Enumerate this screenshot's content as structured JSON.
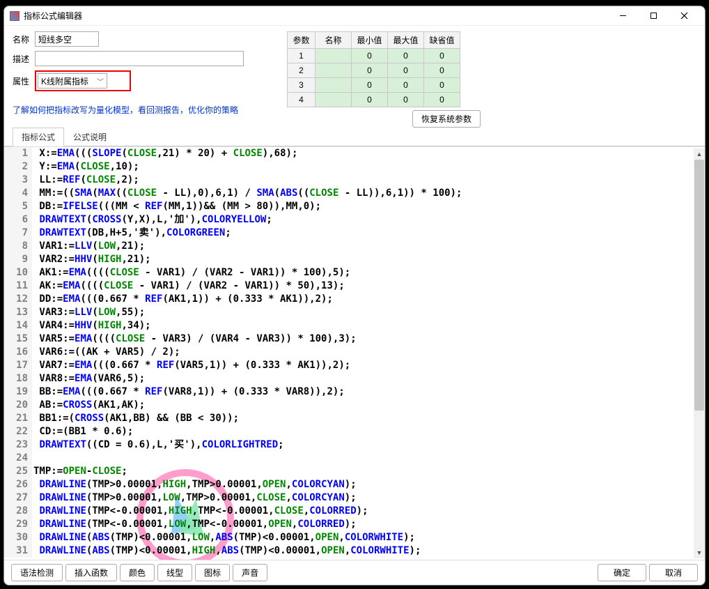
{
  "window": {
    "title": "指标公式编辑器"
  },
  "form": {
    "name_label": "名称",
    "name_value": "短线多空",
    "desc_label": "描述",
    "desc_value": "",
    "attr_label": "属性",
    "attr_value": "K线附属指标"
  },
  "quant_link": "了解如何把指标改写为量化模型，看回测报告，优化你的策略",
  "params": {
    "headers": {
      "param": "参数",
      "name": "名称",
      "min": "最小值",
      "max": "最大值",
      "def": "缺省值"
    },
    "rows": [
      {
        "idx": "1",
        "name": "",
        "min": "0",
        "max": "0",
        "def": "0"
      },
      {
        "idx": "2",
        "name": "",
        "min": "0",
        "max": "0",
        "def": "0"
      },
      {
        "idx": "3",
        "name": "",
        "min": "0",
        "max": "0",
        "def": "0"
      },
      {
        "idx": "4",
        "name": "",
        "min": "0",
        "max": "0",
        "def": "0"
      }
    ],
    "restore": "恢复系统参数"
  },
  "tabs": {
    "formula": "指标公式",
    "desc": "公式说明"
  },
  "footer": {
    "syntax": "语法检测",
    "insert_fn": "插入函数",
    "color": "颜色",
    "line": "线型",
    "icon": "图标",
    "sound": "声音",
    "ok": "确定",
    "cancel": "取消"
  },
  "code": [
    {
      "n": "1",
      "seg": [
        [
          "blk",
          " X:="
        ],
        [
          "kw",
          "EMA"
        ],
        [
          "blk",
          "((("
        ],
        [
          "kw",
          "SLOPE"
        ],
        [
          "blk",
          "("
        ],
        [
          "grn",
          "CLOSE"
        ],
        [
          "blk",
          ",21) * 20) + "
        ],
        [
          "grn",
          "CLOSE"
        ],
        [
          "blk",
          "),68);"
        ]
      ]
    },
    {
      "n": "2",
      "seg": [
        [
          "blk",
          " Y:="
        ],
        [
          "kw",
          "EMA"
        ],
        [
          "blk",
          "("
        ],
        [
          "grn",
          "CLOSE"
        ],
        [
          "blk",
          ",10);"
        ]
      ]
    },
    {
      "n": "3",
      "seg": [
        [
          "blk",
          " LL:="
        ],
        [
          "kw",
          "REF"
        ],
        [
          "blk",
          "("
        ],
        [
          "grn",
          "CLOSE"
        ],
        [
          "blk",
          ",2);"
        ]
      ]
    },
    {
      "n": "4",
      "seg": [
        [
          "blk",
          " MM:=(("
        ],
        [
          "kw",
          "SMA"
        ],
        [
          "blk",
          "("
        ],
        [
          "kw",
          "MAX"
        ],
        [
          "blk",
          "(("
        ],
        [
          "grn",
          "CLOSE"
        ],
        [
          "blk",
          " - LL),0),6,1) / "
        ],
        [
          "kw",
          "SMA"
        ],
        [
          "blk",
          "("
        ],
        [
          "kw",
          "ABS"
        ],
        [
          "blk",
          "(("
        ],
        [
          "grn",
          "CLOSE"
        ],
        [
          "blk",
          " - LL)),6,1)) * 100);"
        ]
      ]
    },
    {
      "n": "5",
      "seg": [
        [
          "blk",
          " DB:="
        ],
        [
          "kw",
          "IFELSE"
        ],
        [
          "blk",
          "(((MM < "
        ],
        [
          "kw",
          "REF"
        ],
        [
          "blk",
          "(MM,1))&& (MM > 80)),MM,0);"
        ]
      ]
    },
    {
      "n": "6",
      "seg": [
        [
          "blk",
          " "
        ],
        [
          "kw",
          "DRAWTEXT"
        ],
        [
          "blk",
          "("
        ],
        [
          "kw",
          "CROSS"
        ],
        [
          "blk",
          "(Y,X),L,'加'),"
        ],
        [
          "kw",
          "COLORYELLOW"
        ],
        [
          "blk",
          ";"
        ]
      ]
    },
    {
      "n": "7",
      "seg": [
        [
          "blk",
          " "
        ],
        [
          "kw",
          "DRAWTEXT"
        ],
        [
          "blk",
          "(DB,H+5,'卖'),"
        ],
        [
          "kw",
          "COLORGREEN"
        ],
        [
          "blk",
          ";"
        ]
      ]
    },
    {
      "n": "8",
      "seg": [
        [
          "blk",
          " VAR1:="
        ],
        [
          "kw",
          "LLV"
        ],
        [
          "blk",
          "("
        ],
        [
          "grn",
          "LOW"
        ],
        [
          "blk",
          ",21);"
        ]
      ]
    },
    {
      "n": "9",
      "seg": [
        [
          "blk",
          " VAR2:="
        ],
        [
          "kw",
          "HHV"
        ],
        [
          "blk",
          "("
        ],
        [
          "grn",
          "HIGH"
        ],
        [
          "blk",
          ",21);"
        ]
      ]
    },
    {
      "n": "10",
      "seg": [
        [
          "blk",
          " AK1:="
        ],
        [
          "kw",
          "EMA"
        ],
        [
          "blk",
          "(((("
        ],
        [
          "grn",
          "CLOSE"
        ],
        [
          "blk",
          " - VAR1) / (VAR2 - VAR1)) * 100),5);"
        ]
      ]
    },
    {
      "n": "11",
      "seg": [
        [
          "blk",
          " AK:="
        ],
        [
          "kw",
          "EMA"
        ],
        [
          "blk",
          "(((("
        ],
        [
          "grn",
          "CLOSE"
        ],
        [
          "blk",
          " - VAR1) / (VAR2 - VAR1)) * 50),13);"
        ]
      ]
    },
    {
      "n": "12",
      "seg": [
        [
          "blk",
          " DD:="
        ],
        [
          "kw",
          "EMA"
        ],
        [
          "blk",
          "(((0.667 * "
        ],
        [
          "kw",
          "REF"
        ],
        [
          "blk",
          "(AK1,1)) + (0.333 * AK1)),2);"
        ]
      ]
    },
    {
      "n": "13",
      "seg": [
        [
          "blk",
          " VAR3:="
        ],
        [
          "kw",
          "LLV"
        ],
        [
          "blk",
          "("
        ],
        [
          "grn",
          "LOW"
        ],
        [
          "blk",
          ",55);"
        ]
      ]
    },
    {
      "n": "14",
      "seg": [
        [
          "blk",
          " VAR4:="
        ],
        [
          "kw",
          "HHV"
        ],
        [
          "blk",
          "("
        ],
        [
          "grn",
          "HIGH"
        ],
        [
          "blk",
          ",34);"
        ]
      ]
    },
    {
      "n": "15",
      "seg": [
        [
          "blk",
          " VAR5:="
        ],
        [
          "kw",
          "EMA"
        ],
        [
          "blk",
          "(((("
        ],
        [
          "grn",
          "CLOSE"
        ],
        [
          "blk",
          " - VAR3) / (VAR4 - VAR3)) * 100),3);"
        ]
      ]
    },
    {
      "n": "16",
      "seg": [
        [
          "blk",
          " VAR6:=((AK + VAR5) / 2);"
        ]
      ]
    },
    {
      "n": "17",
      "seg": [
        [
          "blk",
          " VAR7:="
        ],
        [
          "kw",
          "EMA"
        ],
        [
          "blk",
          "(((0.667 * "
        ],
        [
          "kw",
          "REF"
        ],
        [
          "blk",
          "(VAR5,1)) + (0.333 * AK1)),2);"
        ]
      ]
    },
    {
      "n": "18",
      "seg": [
        [
          "blk",
          " VAR8:="
        ],
        [
          "kw",
          "EMA"
        ],
        [
          "blk",
          "(VAR6,5);"
        ]
      ]
    },
    {
      "n": "19",
      "seg": [
        [
          "blk",
          " BB:="
        ],
        [
          "kw",
          "EMA"
        ],
        [
          "blk",
          "(((0.667 * "
        ],
        [
          "kw",
          "REF"
        ],
        [
          "blk",
          "(VAR8,1)) + (0.333 * VAR8)),2);"
        ]
      ]
    },
    {
      "n": "20",
      "seg": [
        [
          "blk",
          " AB:="
        ],
        [
          "kw",
          "CROSS"
        ],
        [
          "blk",
          "(AK1,AK);"
        ]
      ]
    },
    {
      "n": "21",
      "seg": [
        [
          "blk",
          " BB1:=("
        ],
        [
          "kw",
          "CROSS"
        ],
        [
          "blk",
          "(AK1,BB) && (BB < 30));"
        ]
      ]
    },
    {
      "n": "22",
      "seg": [
        [
          "blk",
          " CD:=(BB1 * 0.6);"
        ]
      ]
    },
    {
      "n": "23",
      "seg": [
        [
          "blk",
          " "
        ],
        [
          "kw",
          "DRAWTEXT"
        ],
        [
          "blk",
          "((CD = 0.6),L,'买'),"
        ],
        [
          "kw",
          "COLORLIGHTRED"
        ],
        [
          "blk",
          ";"
        ]
      ]
    },
    {
      "n": "24",
      "seg": [
        [
          "blk",
          ""
        ]
      ]
    },
    {
      "n": "25",
      "seg": [
        [
          "blk",
          "TMP:="
        ],
        [
          "grn",
          "OPEN"
        ],
        [
          "blk",
          "-"
        ],
        [
          "grn",
          "CLOSE"
        ],
        [
          "blk",
          ";"
        ]
      ]
    },
    {
      "n": "26",
      "seg": [
        [
          "blk",
          " "
        ],
        [
          "kw",
          "DRAWLINE"
        ],
        [
          "blk",
          "(TMP>0.00001,"
        ],
        [
          "grn",
          "HIGH"
        ],
        [
          "blk",
          ",TMP>0.00001,"
        ],
        [
          "grn",
          "OPEN"
        ],
        [
          "blk",
          ","
        ],
        [
          "kw",
          "COLORCYAN"
        ],
        [
          "blk",
          ");"
        ]
      ]
    },
    {
      "n": "27",
      "seg": [
        [
          "blk",
          " "
        ],
        [
          "kw",
          "DRAWLINE"
        ],
        [
          "blk",
          "(TMP>0.00001,"
        ],
        [
          "grn",
          "LOW"
        ],
        [
          "blk",
          ",TMP>0.00001,"
        ],
        [
          "grn",
          "CLOSE"
        ],
        [
          "blk",
          ","
        ],
        [
          "kw",
          "COLORCYAN"
        ],
        [
          "blk",
          ");"
        ]
      ]
    },
    {
      "n": "28",
      "seg": [
        [
          "blk",
          " "
        ],
        [
          "kw",
          "DRAWLINE"
        ],
        [
          "blk",
          "(TMP<-0.00001,"
        ],
        [
          "grn",
          "HIGH"
        ],
        [
          "blk",
          ",TMP<-0.00001,"
        ],
        [
          "grn",
          "CLOSE"
        ],
        [
          "blk",
          ","
        ],
        [
          "kw",
          "COLORRED"
        ],
        [
          "blk",
          ");"
        ]
      ]
    },
    {
      "n": "29",
      "seg": [
        [
          "blk",
          " "
        ],
        [
          "kw",
          "DRAWLINE"
        ],
        [
          "blk",
          "(TMP<-0.00001,"
        ],
        [
          "grn",
          "LOW"
        ],
        [
          "blk",
          ",TMP<-0.00001,"
        ],
        [
          "grn",
          "OPEN"
        ],
        [
          "blk",
          ","
        ],
        [
          "kw",
          "COLORRED"
        ],
        [
          "blk",
          ");"
        ]
      ]
    },
    {
      "n": "30",
      "seg": [
        [
          "blk",
          " "
        ],
        [
          "kw",
          "DRAWLINE"
        ],
        [
          "blk",
          "("
        ],
        [
          "kw",
          "ABS"
        ],
        [
          "blk",
          "(TMP)<0.00001,"
        ],
        [
          "grn",
          "LOW"
        ],
        [
          "blk",
          ","
        ],
        [
          "kw",
          "ABS"
        ],
        [
          "blk",
          "(TMP)<0.00001,"
        ],
        [
          "grn",
          "OPEN"
        ],
        [
          "blk",
          ","
        ],
        [
          "kw",
          "COLORWHITE"
        ],
        [
          "blk",
          ");"
        ]
      ]
    },
    {
      "n": "31",
      "seg": [
        [
          "blk",
          " "
        ],
        [
          "kw",
          "DRAWLINE"
        ],
        [
          "blk",
          "("
        ],
        [
          "kw",
          "ABS"
        ],
        [
          "blk",
          "(TMP)<0.00001,"
        ],
        [
          "grn",
          "HIGH"
        ],
        [
          "blk",
          ","
        ],
        [
          "kw",
          "ABS"
        ],
        [
          "blk",
          "(TMP)<0.00001,"
        ],
        [
          "grn",
          "OPEN"
        ],
        [
          "blk",
          ","
        ],
        [
          "kw",
          "COLORWHITE"
        ],
        [
          "blk",
          ");"
        ]
      ]
    }
  ]
}
